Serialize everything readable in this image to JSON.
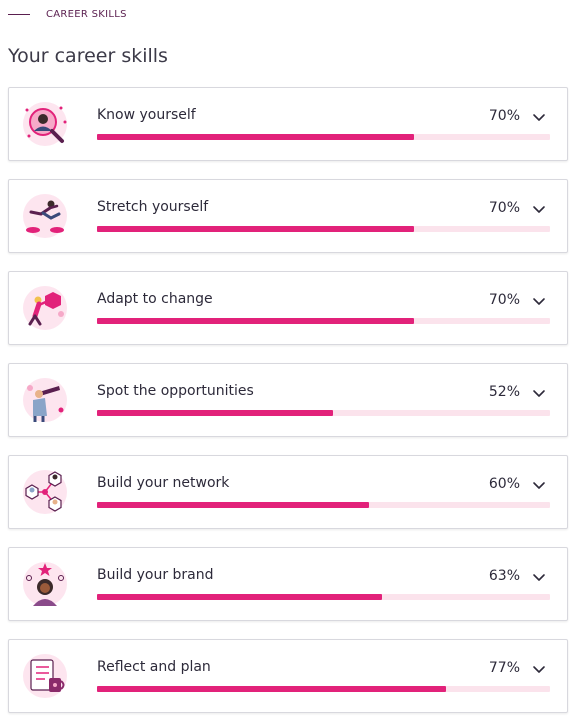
{
  "header": {
    "eyebrow": "CAREER SKILLS",
    "title": "Your career skills"
  },
  "colors": {
    "accent": "#e2227a",
    "track": "#fbe3ec",
    "eyebrow": "#5a1f4f",
    "text": "#2d2a3a"
  },
  "skills": [
    {
      "label": "Know yourself",
      "percent_text": "70%",
      "progress": 0.7,
      "icon": "magnifier-person-icon"
    },
    {
      "label": "Stretch yourself",
      "percent_text": "70%",
      "progress": 0.7,
      "icon": "leaping-person-icon"
    },
    {
      "label": "Adapt to change",
      "percent_text": "70%",
      "progress": 0.7,
      "icon": "person-pushing-icon"
    },
    {
      "label": "Spot the opportunities",
      "percent_text": "52%",
      "progress": 0.52,
      "icon": "telescope-person-icon"
    },
    {
      "label": "Build your network",
      "percent_text": "60%",
      "progress": 0.6,
      "icon": "network-people-icon"
    },
    {
      "label": "Build your brand",
      "percent_text": "63%",
      "progress": 0.63,
      "icon": "brand-star-person-icon"
    },
    {
      "label": "Reflect and plan",
      "percent_text": "77%",
      "progress": 0.77,
      "icon": "checklist-mug-icon"
    }
  ]
}
